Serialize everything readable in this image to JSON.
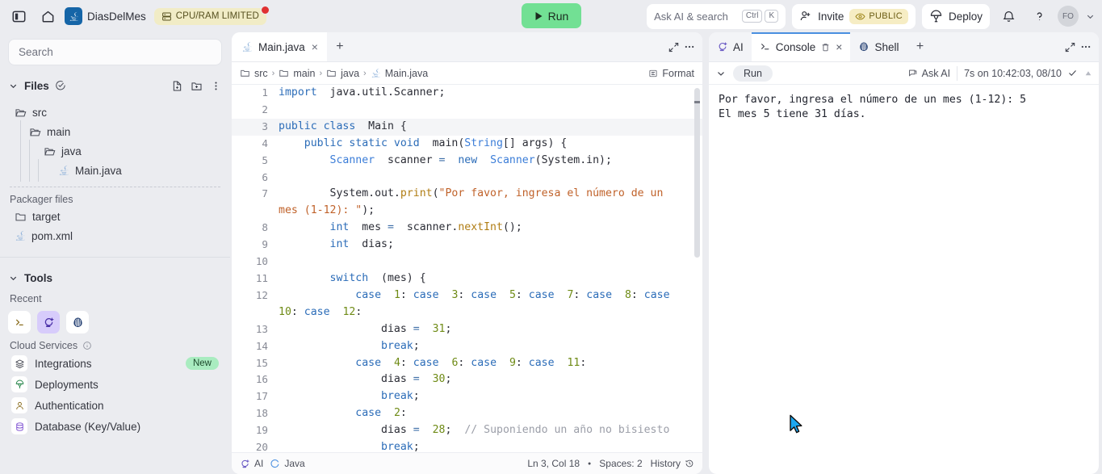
{
  "topbar": {
    "sidebar_toggle_icon": "panel-left-icon",
    "home_icon": "home-icon",
    "project_icon": "java-icon",
    "project_name": "DiasDelMes",
    "cpu_badge": {
      "label": "CPU/RAM LIMITED",
      "icon": "server-icon",
      "dot_color": "#e03131",
      "bg": "#f1ecc6"
    },
    "run_button": {
      "label": "Run",
      "icon": "play-icon",
      "bg": "#72e094"
    },
    "search": {
      "text": "Ask AI & search",
      "keys": [
        "Ctrl",
        "K"
      ],
      "icon": "search-icon"
    },
    "invite": {
      "label": "Invite",
      "icon": "person-plus-icon"
    },
    "public_badge": {
      "label": "PUBLIC",
      "icon": "eye-icon",
      "bg": "#f6edc4"
    },
    "deploy": {
      "label": "Deploy",
      "icon": "deploy-icon"
    },
    "bell_icon": "bell-icon",
    "help_icon": "question-mark-icon",
    "avatar_initials": "FO",
    "avatar_chevron": "chevron-down-icon"
  },
  "sidebar": {
    "search_placeholder": "Search",
    "files": {
      "title": "Files",
      "chevron": "chevron-down-icon",
      "check_icon": "check-circle-icon",
      "actions": [
        "new-file-icon",
        "new-folder-icon",
        "more-vertical-icon"
      ],
      "tree": [
        {
          "label": "src",
          "type": "folder",
          "indent": 1
        },
        {
          "label": "main",
          "type": "folder",
          "indent": 2
        },
        {
          "label": "java",
          "type": "folder",
          "indent": 3
        },
        {
          "label": "Main.java",
          "type": "java",
          "indent": 4
        }
      ],
      "packager_label": "Packager files",
      "packager": [
        {
          "label": "target",
          "type": "folder-closed",
          "indent": 1
        },
        {
          "label": "pom.xml",
          "type": "java",
          "indent": 1
        }
      ]
    },
    "tools": {
      "title": "Tools",
      "chevron": "chevron-down-icon",
      "recent_label": "Recent",
      "recent_icons": [
        {
          "name": "shell-prompt-icon",
          "active": false
        },
        {
          "name": "ai-agent-icon",
          "active": true
        },
        {
          "name": "nix-shell-icon",
          "active": false
        }
      ],
      "cloud_label": "Cloud Services",
      "cloud_info_icon": "info-icon",
      "cloud_items": [
        {
          "label": "Integrations",
          "icon": "layers-icon",
          "badge": "New"
        },
        {
          "label": "Deployments",
          "icon": "deploy-tree-icon",
          "badge": ""
        },
        {
          "label": "Authentication",
          "icon": "person-icon",
          "badge": ""
        },
        {
          "label": "Database (Key/Value)",
          "icon": "database-icon",
          "badge": ""
        }
      ]
    }
  },
  "editor": {
    "tabs": [
      {
        "label": "Main.java",
        "icon": "java-icon",
        "active": true,
        "close": "×"
      }
    ],
    "add_tab_icon": "plus-icon",
    "expand_icon": "expand-icon",
    "more_icon": "more-horizontal-icon",
    "breadcrumb": [
      {
        "label": "src",
        "icon": "folder-icon"
      },
      {
        "label": "main",
        "icon": "folder-icon"
      },
      {
        "label": "java",
        "icon": "folder-icon"
      },
      {
        "label": "Main.java",
        "icon": "java-icon"
      }
    ],
    "breadcrumb_sep": "›",
    "format_label": "Format",
    "format_icon": "format-icon",
    "current_line": 3,
    "lines": [
      {
        "n": 1,
        "tokens": [
          [
            "kw",
            "import"
          ],
          [
            "",
            "  java.util.Scanner;"
          ]
        ]
      },
      {
        "n": 2,
        "tokens": [
          [
            "",
            ""
          ]
        ]
      },
      {
        "n": 3,
        "tokens": [
          [
            "kw",
            "public class"
          ],
          [
            "",
            "  Main {"
          ]
        ]
      },
      {
        "n": 4,
        "tokens": [
          [
            "",
            "    "
          ],
          [
            "kw",
            "public static void"
          ],
          [
            "",
            "  main("
          ],
          [
            "typ",
            "String"
          ],
          [
            "",
            "[] args) {"
          ]
        ]
      },
      {
        "n": 5,
        "tokens": [
          [
            "",
            "        "
          ],
          [
            "typ",
            "Scanner"
          ],
          [
            "",
            "  scanner "
          ],
          [
            "op",
            "="
          ],
          [
            "",
            "  "
          ],
          [
            "kw",
            "new"
          ],
          [
            "",
            "  "
          ],
          [
            "typ",
            "Scanner"
          ],
          [
            "",
            "(System.in);"
          ]
        ]
      },
      {
        "n": 6,
        "tokens": [
          [
            "",
            ""
          ]
        ]
      },
      {
        "n": 7,
        "tokens": [
          [
            "",
            "        System.out."
          ],
          [
            "fn",
            "print"
          ],
          [
            "",
            "("
          ],
          [
            "str",
            "\"Por favor, ingresa el número de un mes (1-12): \""
          ],
          [
            "",
            ");"
          ]
        ]
      },
      {
        "n": 8,
        "tokens": [
          [
            "",
            "        "
          ],
          [
            "kw",
            "int"
          ],
          [
            "",
            "  mes "
          ],
          [
            "op",
            "="
          ],
          [
            "",
            "  scanner."
          ],
          [
            "fn",
            "nextInt"
          ],
          [
            "",
            "();"
          ]
        ]
      },
      {
        "n": 9,
        "tokens": [
          [
            "",
            "        "
          ],
          [
            "kw",
            "int"
          ],
          [
            "",
            "  dias;"
          ]
        ]
      },
      {
        "n": 10,
        "tokens": [
          [
            "",
            ""
          ]
        ]
      },
      {
        "n": 11,
        "tokens": [
          [
            "",
            "        "
          ],
          [
            "kw",
            "switch"
          ],
          [
            "",
            "  (mes) {"
          ]
        ]
      },
      {
        "n": 12,
        "tokens": [
          [
            "",
            "            "
          ],
          [
            "kw",
            "case"
          ],
          [
            "",
            "  "
          ],
          [
            "num",
            "1"
          ],
          [
            "",
            ": "
          ],
          [
            "kw",
            "case"
          ],
          [
            "",
            "  "
          ],
          [
            "num",
            "3"
          ],
          [
            "",
            ": "
          ],
          [
            "kw",
            "case"
          ],
          [
            "",
            "  "
          ],
          [
            "num",
            "5"
          ],
          [
            "",
            ": "
          ],
          [
            "kw",
            "case"
          ],
          [
            "",
            "  "
          ],
          [
            "num",
            "7"
          ],
          [
            "",
            ": "
          ],
          [
            "kw",
            "case"
          ],
          [
            "",
            "  "
          ],
          [
            "num",
            "8"
          ],
          [
            "",
            ": "
          ],
          [
            "kw",
            "case"
          ],
          [
            "",
            "  "
          ],
          [
            "num",
            "10"
          ],
          [
            "",
            ": "
          ],
          [
            "kw",
            "case"
          ],
          [
            "",
            "  "
          ],
          [
            "num",
            "12"
          ],
          [
            "",
            ":"
          ]
        ]
      },
      {
        "n": 13,
        "tokens": [
          [
            "",
            "                dias "
          ],
          [
            "op",
            "="
          ],
          [
            "",
            "  "
          ],
          [
            "num",
            "31"
          ],
          [
            "",
            ";"
          ]
        ]
      },
      {
        "n": 14,
        "tokens": [
          [
            "",
            "                "
          ],
          [
            "kw",
            "break"
          ],
          [
            "",
            ";"
          ]
        ]
      },
      {
        "n": 15,
        "tokens": [
          [
            "",
            "            "
          ],
          [
            "kw",
            "case"
          ],
          [
            "",
            "  "
          ],
          [
            "num",
            "4"
          ],
          [
            "",
            ": "
          ],
          [
            "kw",
            "case"
          ],
          [
            "",
            "  "
          ],
          [
            "num",
            "6"
          ],
          [
            "",
            ": "
          ],
          [
            "kw",
            "case"
          ],
          [
            "",
            "  "
          ],
          [
            "num",
            "9"
          ],
          [
            "",
            ": "
          ],
          [
            "kw",
            "case"
          ],
          [
            "",
            "  "
          ],
          [
            "num",
            "11"
          ],
          [
            "",
            ":"
          ]
        ]
      },
      {
        "n": 16,
        "tokens": [
          [
            "",
            "                dias "
          ],
          [
            "op",
            "="
          ],
          [
            "",
            "  "
          ],
          [
            "num",
            "30"
          ],
          [
            "",
            ";"
          ]
        ]
      },
      {
        "n": 17,
        "tokens": [
          [
            "",
            "                "
          ],
          [
            "kw",
            "break"
          ],
          [
            "",
            ";"
          ]
        ]
      },
      {
        "n": 18,
        "tokens": [
          [
            "",
            "            "
          ],
          [
            "kw",
            "case"
          ],
          [
            "",
            "  "
          ],
          [
            "num",
            "2"
          ],
          [
            "",
            ":"
          ]
        ]
      },
      {
        "n": 19,
        "tokens": [
          [
            "",
            "                dias "
          ],
          [
            "op",
            "="
          ],
          [
            "",
            "  "
          ],
          [
            "num",
            "28"
          ],
          [
            "",
            ";  "
          ],
          [
            "cmt",
            "// Suponiendo un año no bisiesto"
          ]
        ]
      },
      {
        "n": 20,
        "tokens": [
          [
            "",
            "                "
          ],
          [
            "kw",
            "break"
          ],
          [
            "",
            ";"
          ]
        ]
      }
    ],
    "statusbar": {
      "ai_label": "AI",
      "ai_icon": "ai-agent-icon",
      "lang_label": "Java",
      "lang_icon": "java-loading-icon",
      "position": "Ln 3, Col 18",
      "dot": "●",
      "spaces": "Spaces: 2",
      "history": "History",
      "history_icon": "history-icon"
    }
  },
  "console": {
    "tabs": [
      {
        "label": "AI",
        "icon": "ai-agent-icon",
        "active": false,
        "closable": false
      },
      {
        "label": "Console",
        "icon": "terminal-icon",
        "active": true,
        "closable": true,
        "trash": "trash-icon",
        "close": "×"
      },
      {
        "label": "Shell",
        "icon": "nix-shell-icon",
        "active": false,
        "closable": false
      }
    ],
    "add_tab_icon": "plus-icon",
    "expand_icon": "expand-icon",
    "more_icon": "more-horizontal-icon",
    "toolbar": {
      "collapse_icon": "chevron-down-icon",
      "run_chip": "Run",
      "ask_ai": "Ask AI",
      "ask_ai_icon": "chat-icon",
      "status": "7s on 10:42:03, 08/10",
      "check_icon": "check-icon",
      "scroll_icon": "caret-up-icon"
    },
    "output": "Por favor, ingresa el número de un mes (1-12): 5\nEl mes 5 tiene 31 días."
  }
}
